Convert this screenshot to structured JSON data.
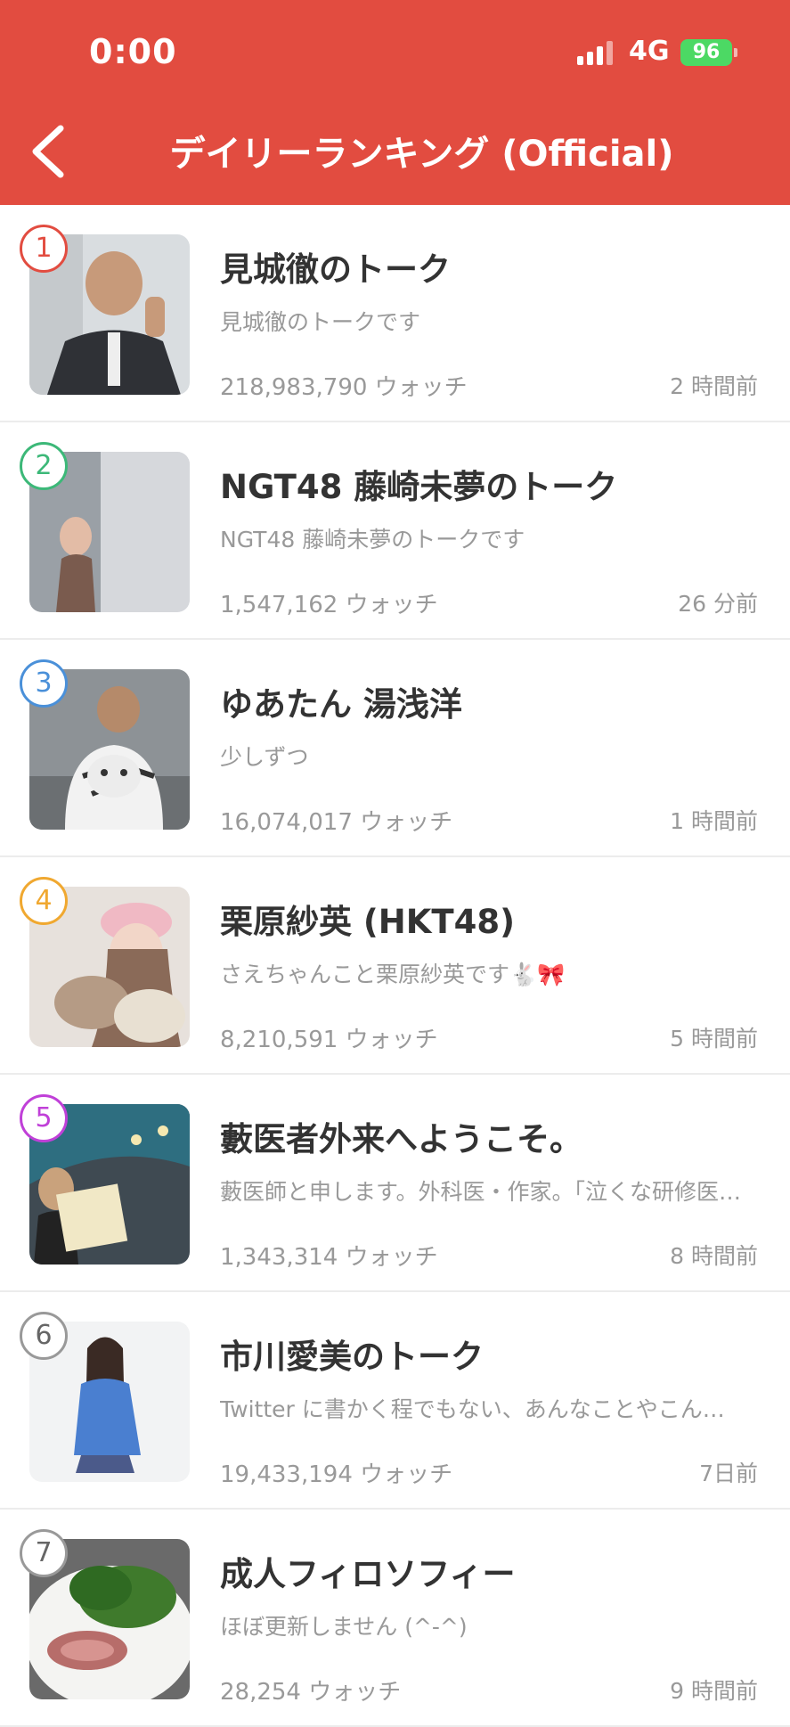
{
  "status_bar": {
    "time": "0:00",
    "network": "4G",
    "battery": "96"
  },
  "nav": {
    "title": "デイリーランキング (Official)",
    "back_icon": "chevron-left-icon"
  },
  "colors": {
    "header": "#e24c40",
    "rank_colors": [
      "#e24c40",
      "#3cb878",
      "#4a90d9",
      "#f0a830",
      "#c040d8",
      "#999999",
      "#999999"
    ]
  },
  "items": [
    {
      "rank": "1",
      "title": "見城徹のトーク",
      "desc": "見城徹のトークです",
      "watch": "218,983,790 ウォッチ",
      "ago": "2 時間前"
    },
    {
      "rank": "2",
      "title": "NGT48 藤崎未夢のトーク",
      "desc": "NGT48 藤崎未夢のトークです",
      "watch": "1,547,162 ウォッチ",
      "ago": "26 分前"
    },
    {
      "rank": "3",
      "title": "ゆあたん 湯浅洋",
      "desc": "少しずつ",
      "watch": "16,074,017 ウォッチ",
      "ago": "1 時間前"
    },
    {
      "rank": "4",
      "title": "栗原紗英 (HKT48)",
      "desc": "さえちゃんこと栗原紗英です🐇🎀",
      "watch": "8,210,591 ウォッチ",
      "ago": "5 時間前"
    },
    {
      "rank": "5",
      "title": "藪医者外来へようこそ。",
      "desc": "藪医師と申します。外科医・作家。「泣くな研修医…",
      "watch": "1,343,314 ウォッチ",
      "ago": "8 時間前"
    },
    {
      "rank": "6",
      "title": "市川愛美のトーク",
      "desc": "Twitter に書かく程でもない、あんなことやこん…",
      "watch": "19,433,194 ウォッチ",
      "ago": "7日前"
    },
    {
      "rank": "7",
      "title": "成人フィロソフィー",
      "desc": "ほぼ更新しません (^-^)",
      "watch": "28,254 ウォッチ",
      "ago": "9 時間前"
    }
  ]
}
